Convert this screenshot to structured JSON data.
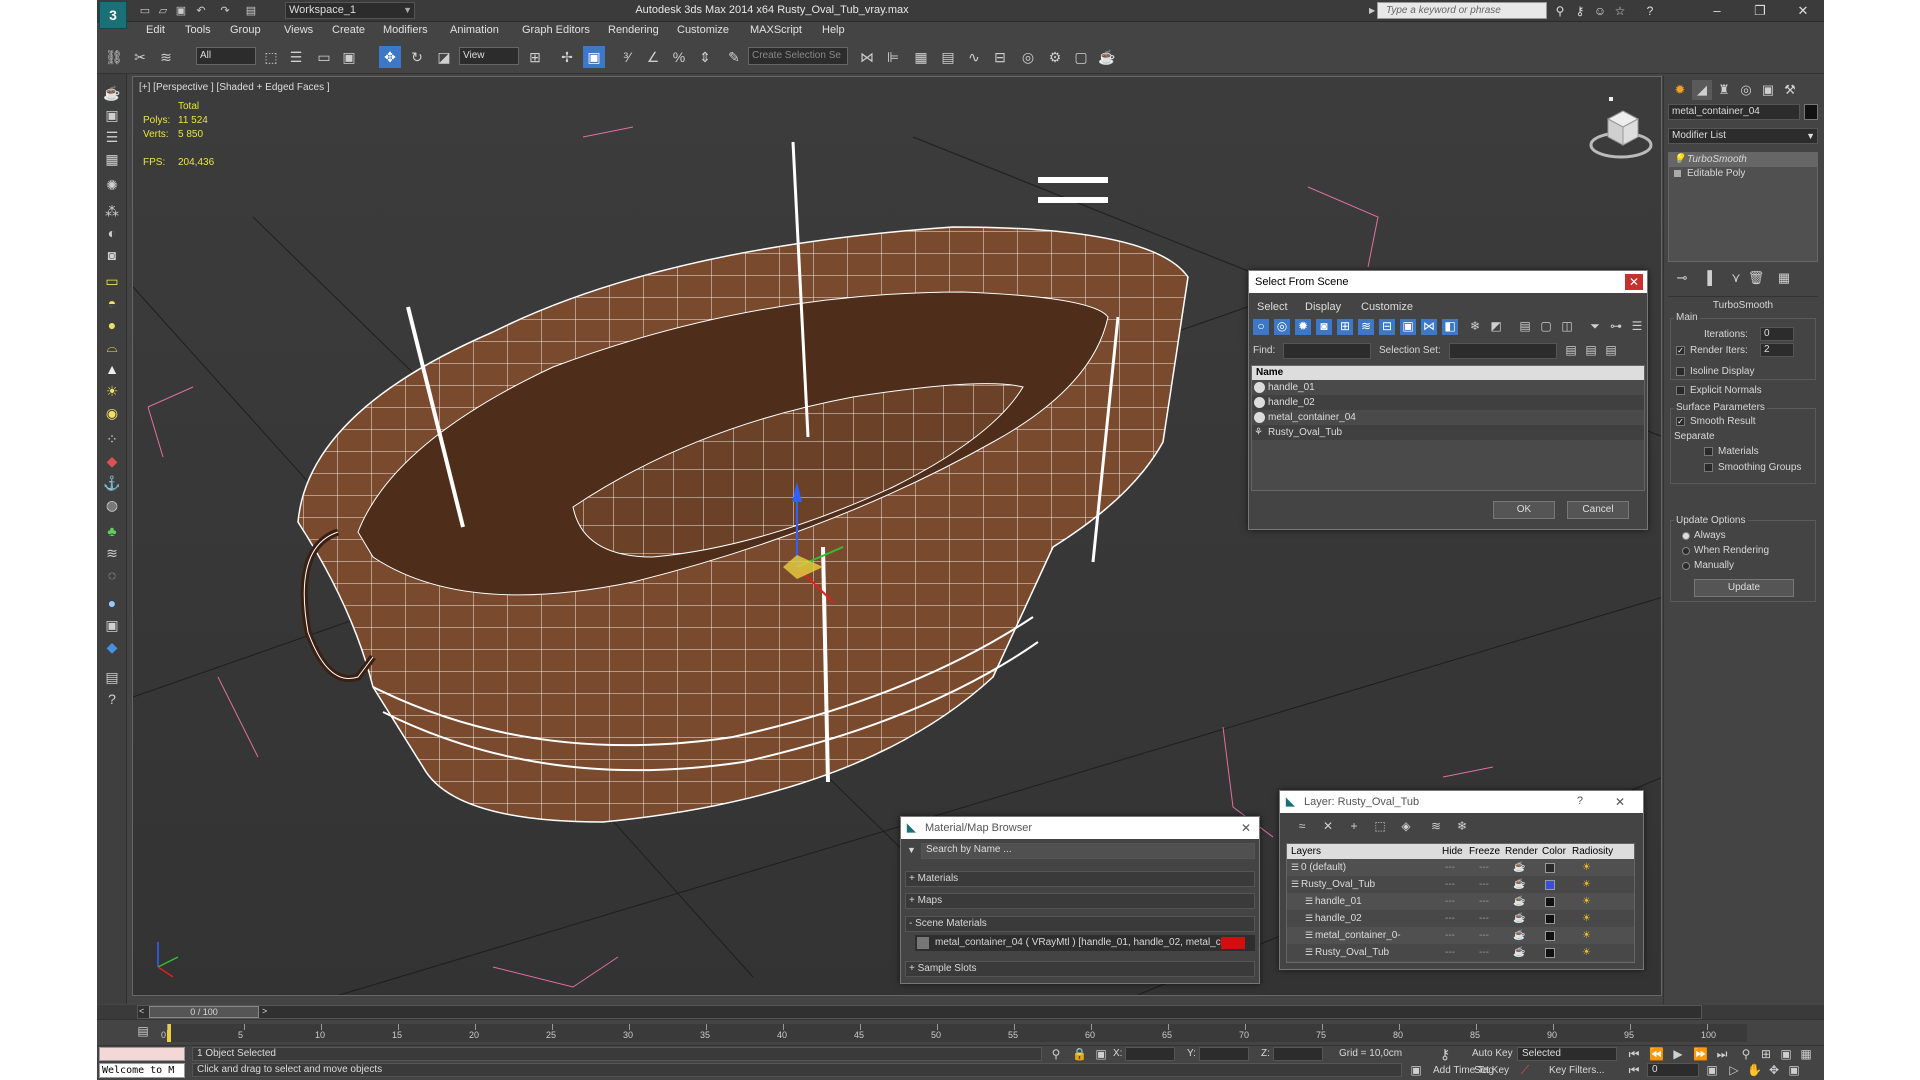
{
  "window": {
    "title": "Autodesk 3ds Max  2014 x64     Rusty_Oval_Tub_vray.max",
    "workspace": "Workspace_1",
    "search_placeholder": "Type a keyword or phrase"
  },
  "menu": [
    "Edit",
    "Tools",
    "Group",
    "Views",
    "Create",
    "Modifiers",
    "Animation",
    "Graph Editors",
    "Rendering",
    "Customize",
    "MAXScript",
    "Help"
  ],
  "toolbar": {
    "filter": "All",
    "refcoord": "View",
    "selection_set": "Create Selection Se"
  },
  "viewport": {
    "label": "[+] [Perspective ] [Shaded + Edged Faces ]",
    "stats": {
      "total_label": "Total",
      "polys_label": "Polys:",
      "polys": "11 524",
      "verts_label": "Verts:",
      "verts": "5 850",
      "fps_label": "FPS:",
      "fps": "204,436"
    }
  },
  "command_panel": {
    "object_name": "metal_container_04",
    "modifier_list": "Modifier List",
    "stack": [
      "TurboSmooth",
      "Editable Poly"
    ],
    "rollout_title": "TurboSmooth",
    "main_label": "Main",
    "iterations_label": "Iterations:",
    "iterations": "0",
    "render_iters_label": "Render Iters:",
    "render_iters": "2",
    "isoline": "Isoline Display",
    "explicit_normals": "Explicit Normals",
    "surface_params": "Surface Parameters",
    "smooth_result": "Smooth Result",
    "separate": "Separate",
    "materials": "Materials",
    "smoothing_groups": "Smoothing Groups",
    "update_options": "Update Options",
    "always": "Always",
    "when_rendering": "When Rendering",
    "manually": "Manually",
    "update_btn": "Update"
  },
  "select_dialog": {
    "title": "Select From Scene",
    "menu": [
      "Select",
      "Display",
      "Customize"
    ],
    "find_label": "Find:",
    "selset_label": "Selection Set:",
    "col_name": "Name",
    "items": [
      "handle_01",
      "handle_02",
      "metal_container_04",
      "Rusty_Oval_Tub"
    ],
    "ok": "OK",
    "cancel": "Cancel"
  },
  "material_browser": {
    "title": "Material/Map Browser",
    "search_placeholder": "Search by Name ...",
    "groups": [
      "+ Materials",
      "+ Maps",
      "- Scene Materials",
      "+ Sample Slots"
    ],
    "scene_material": "metal_container_04  ( VRayMtl )  [handle_01, handle_02, metal_co..."
  },
  "layer_dialog": {
    "title": "Layer: Rusty_Oval_Tub",
    "help": "?",
    "columns": [
      "Layers",
      "Hide",
      "Freeze",
      "Render",
      "Color",
      "Radiosity"
    ],
    "rows": [
      {
        "name": "0 (default)",
        "color": "#2a2a2a"
      },
      {
        "name": "Rusty_Oval_Tub",
        "color": "#3b4fd6"
      },
      {
        "name": "handle_01",
        "color": "#111111"
      },
      {
        "name": "handle_02",
        "color": "#111111"
      },
      {
        "name": "metal_container_0-",
        "color": "#111111"
      },
      {
        "name": "Rusty_Oval_Tub",
        "color": "#111111"
      }
    ]
  },
  "timeline": {
    "frame": "0 / 100",
    "ticks": [
      "0",
      "5",
      "10",
      "15",
      "20",
      "25",
      "30",
      "35",
      "40",
      "45",
      "50",
      "55",
      "60",
      "65",
      "70",
      "75",
      "80",
      "85",
      "90",
      "95",
      "100"
    ]
  },
  "status": {
    "selected": "1 Object Selected",
    "prompt": "Click and drag to select and move objects",
    "maxscript": "Welcome to M",
    "x_label": "X:",
    "y_label": "Y:",
    "z_label": "Z:",
    "grid": "Grid = 10,0cm",
    "add_time_tag": "Add Time Tag",
    "auto_key": "Auto Key",
    "set_key": "Set Key",
    "key_mode": "Selected",
    "key_filters": "Key Filters...",
    "frame_num": "0"
  },
  "colors": {
    "accent": "#3d78c8",
    "ui_bg": "#444444",
    "wire": "#ffffff",
    "tub": "#6b4128"
  }
}
